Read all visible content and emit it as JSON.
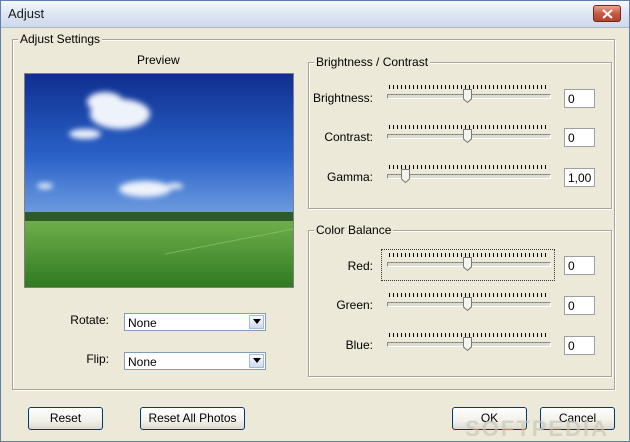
{
  "window": {
    "title": "Adjust"
  },
  "adjust_settings": {
    "legend": "Adjust Settings",
    "preview_label": "Preview"
  },
  "rotate": {
    "label": "Rotate:",
    "value": "None"
  },
  "flip": {
    "label": "Flip:",
    "value": "None"
  },
  "brightness_contrast": {
    "legend": "Brightness / Contrast",
    "brightness": {
      "label": "Brightness:",
      "value": "0",
      "position": 0.5
    },
    "contrast": {
      "label": "Contrast:",
      "value": "0",
      "position": 0.5
    },
    "gamma": {
      "label": "Gamma:",
      "value": "1,00",
      "position": 0.1
    }
  },
  "color_balance": {
    "legend": "Color Balance",
    "red": {
      "label": "Red:",
      "value": "0",
      "position": 0.5
    },
    "green": {
      "label": "Green:",
      "value": "0",
      "position": 0.5
    },
    "blue": {
      "label": "Blue:",
      "value": "0",
      "position": 0.5
    }
  },
  "buttons": {
    "reset": "Reset",
    "reset_all": "Reset All Photos",
    "ok": "OK",
    "cancel": "Cancel"
  },
  "watermark": "SOFTPEDIA",
  "colors": {
    "sky": "#1f4fb5",
    "field": "#3f8a2c",
    "button_border": "#003c74"
  },
  "icons": {
    "close": "close-icon",
    "dropdown": "chevron-down-icon"
  }
}
